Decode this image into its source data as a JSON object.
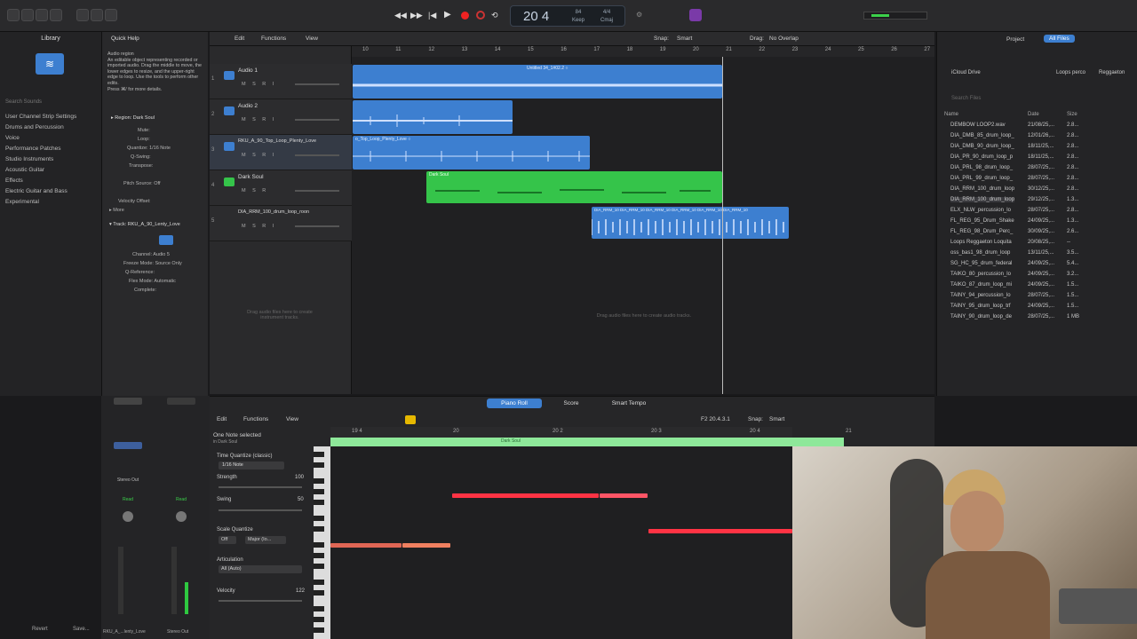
{
  "transport": {
    "bars_beats": "20  4",
    "tempo": "84",
    "tempo_label": "Keep",
    "signature": "4/4",
    "key": "Cmaj"
  },
  "library": {
    "title": "Library",
    "search_placeholder": "Search Sounds",
    "items": [
      "User Channel Strip Settings",
      "Drums and Percussion",
      "Voice",
      "Performance Patches",
      "Studio Instruments",
      "Acoustic Guitar",
      "Effects",
      "Electric Guitar and Bass",
      "Experimental"
    ]
  },
  "quick_help": {
    "title": "Quick Help",
    "text": "Audio region\nAn editable object representing recorded or imported audio. Drag the middle to move, the lower edges to resize, and the upper-right edge to loop. Use the tools to perform other edits.\nPress ⌘/ for more details.",
    "region_label": "▸ Region: Dark Soul",
    "params": [
      "Mute:",
      "Loop:",
      "Quantize: 1/16 Note",
      "Q-Swing:",
      "Transpose:",
      "Pitch Source: Off",
      "Velocity Offset:",
      "▸ More"
    ],
    "track_label": "▾ Track: RKU_A_90_Lenty_Love",
    "track_params": [
      "Icon:",
      "Channel: Audio 5",
      "Freeze Mode: Source Only",
      "Q-Reference:",
      "Flex Mode: Automatic",
      "Complete:"
    ]
  },
  "main_menu": [
    "Edit",
    "Functions",
    "View"
  ],
  "snap": {
    "label": "Snap:",
    "value": "Smart",
    "drag_label": "Drag:",
    "drag_value": "No Overlap"
  },
  "ruler": [
    "10",
    "11",
    "12",
    "13",
    "14",
    "15",
    "16",
    "17",
    "18",
    "19",
    "20",
    "21",
    "22",
    "23",
    "24",
    "25",
    "26",
    "27"
  ],
  "tracks": [
    {
      "num": "1",
      "name": "Audio 1",
      "ctrl": "M S R I"
    },
    {
      "num": "2",
      "name": "Audio 2",
      "ctrl": "M S R I"
    },
    {
      "num": "3",
      "name": "RKU_A_90_Top_Loop_Plenty_Love",
      "ctrl": "M S R I"
    },
    {
      "num": "4",
      "name": "Dark Soul",
      "ctrl": "M S R"
    },
    {
      "num": "5",
      "name": "DIA_RRM_100_drum_loop_roon",
      "ctrl": "M S R I"
    }
  ],
  "regions": {
    "r1": "Untitled 34_1#02.2 ○",
    "r3": "o_Top_Loop_Plenty_Love ○",
    "r4": "Dark Soul",
    "r5": "DIA_RRM_10  DIA_RRM_10  DIA_RRM_10  DIA_RRM_10  DIA_RRM_10  DIA_RRM_10"
  },
  "drag_hint_left": "Drag audio files here to create instrument tracks.",
  "drag_hint_main": "Drag audio files here to create audio tracks.",
  "browser": {
    "tabs": [
      "Project",
      "All Files"
    ],
    "path": "iCloud Drive",
    "path_end": "Reggaeton",
    "subpath": "Loops perco",
    "search_placeholder": "Search Files",
    "cols": [
      "Name",
      "Date",
      "Size"
    ],
    "files": [
      {
        "name": "DEMBOW LOOP2.wav",
        "date": "21/08/25,...",
        "size": "2.8..."
      },
      {
        "name": "DIA_DMB_85_drum_loop_",
        "date": "12/01/26,...",
        "size": "2.8..."
      },
      {
        "name": "DIA_DMB_90_drum_loop_",
        "date": "18/11/25,...",
        "size": "2.8..."
      },
      {
        "name": "DIA_PR_90_drum_loop_p",
        "date": "18/11/25,...",
        "size": "2.8..."
      },
      {
        "name": "DIA_PRL_98_drum_loop_",
        "date": "28/07/25,...",
        "size": "2.8..."
      },
      {
        "name": "DIA_PRL_99_drum_loop_",
        "date": "28/07/25,...",
        "size": "2.8..."
      },
      {
        "name": "DIA_RRM_100_drum_loop",
        "date": "30/12/25,...",
        "size": "2.8..."
      },
      {
        "name": "DIA_RRM_100_drum_loop",
        "date": "29/12/25,...",
        "size": "1.3..."
      },
      {
        "name": "ELX_NLW_percussion_lo",
        "date": "28/07/25,...",
        "size": "2.8..."
      },
      {
        "name": "FL_REG_95_Drum_Shake",
        "date": "24/09/25,...",
        "size": "1.3..."
      },
      {
        "name": "FL_REG_98_Drum_Perc_",
        "date": "30/09/25,...",
        "size": "2.6..."
      },
      {
        "name": "Loops Reggaeton Loquita",
        "date": "20/08/25,...",
        "size": "--"
      },
      {
        "name": "oss_bas1_98_drum_loop",
        "date": "13/11/25,...",
        "size": "3.5..."
      },
      {
        "name": "SG_HC_95_drum_federal",
        "date": "24/09/25,...",
        "size": "5.4..."
      },
      {
        "name": "TAIKO_80_percussion_lo",
        "date": "24/09/25,...",
        "size": "3.2..."
      },
      {
        "name": "TAIKO_87_drum_loop_mi",
        "date": "24/09/25,...",
        "size": "1.5..."
      },
      {
        "name": "TAINY_94_percussion_lo",
        "date": "28/07/25,...",
        "size": "1.5..."
      },
      {
        "name": "TAINY_95_drum_loop_trf",
        "date": "24/09/25,...",
        "size": "1.5..."
      },
      {
        "name": "TAINY_90_drum_loop_de",
        "date": "28/07/25,...",
        "size": "1 MB"
      }
    ]
  },
  "editor": {
    "tabs": [
      "Piano Roll",
      "Score",
      "Smart Tempo"
    ],
    "menu": [
      "Edit",
      "Functions",
      "View"
    ],
    "position": "F2  20.4.3.1",
    "snap_label": "Snap:",
    "snap_value": "Smart",
    "selection": "One Note selected",
    "selection_sub": "in Dark Soul",
    "tq_label": "Time Quantize (classic)",
    "tq_value": "1/16 Note",
    "strength_label": "Strength",
    "strength_value": "100",
    "swing_label": "Swing",
    "swing_value": "50",
    "sq_label": "Scale Quantize",
    "sq_off": "Off",
    "sq_scale": "Major (Io...",
    "art_label": "Articulation",
    "art_value": "All (Auto)",
    "vel_label": "Velocity",
    "vel_value": "122",
    "ruler": [
      "19 4",
      "20",
      "20 2",
      "20 3",
      "20 4",
      "21"
    ],
    "region_name": "Dark Soul"
  },
  "inspector_bottom": {
    "revert": "Revert",
    "save": "Save...",
    "ch1": "RKU_A_...lenty_Love",
    "ch2": "Stereo Out",
    "read": "Read",
    "stereo_out": "Stereo Out",
    "group": "Group"
  },
  "colors": {
    "accent_blue": "#3d7fd0",
    "green_region": "#35c44a",
    "note_red": "#ff3344"
  }
}
